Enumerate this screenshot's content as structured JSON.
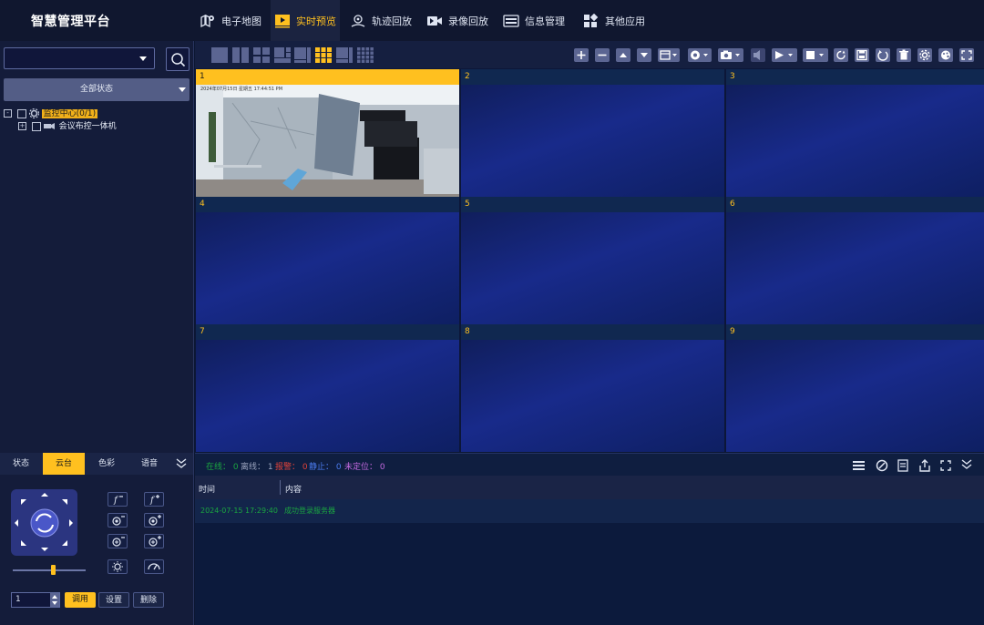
{
  "app": {
    "title": "智慧管理平台"
  },
  "nav": [
    {
      "label": "电子地图",
      "icon": "map-pin-icon",
      "active": false
    },
    {
      "label": "实时预览",
      "icon": "play-icon",
      "active": true
    },
    {
      "label": "轨迹回放",
      "icon": "location-icon",
      "active": false
    },
    {
      "label": "录像回放",
      "icon": "video-camera-icon",
      "active": false
    },
    {
      "label": "信息管理",
      "icon": "database-icon",
      "active": false
    },
    {
      "label": "其他应用",
      "icon": "apps-icon",
      "active": false
    }
  ],
  "left": {
    "device_select": {
      "value": ""
    },
    "status_select": {
      "value": "全部状态"
    },
    "tree": {
      "root": {
        "label": "监控中心(0/1)"
      },
      "child": {
        "label": "会议布控一体机"
      }
    }
  },
  "grid": {
    "cells": [
      "1",
      "2",
      "3",
      "4",
      "5",
      "6",
      "7",
      "8",
      "9"
    ],
    "selected": "1",
    "cam1_overlay": "2024年07月15日 星期五 17:44:51 PM"
  },
  "status": {
    "online_label": "在线：",
    "online": "0",
    "offline_label": "离线：",
    "offline": "1",
    "alarm_label": "报警：",
    "alarm": "0",
    "static_label": "静止：",
    "static": "0",
    "unlocated_label": "未定位：",
    "unlocated": "0",
    "colors": {
      "online": "#1aa541",
      "offline": "#9aa3bd",
      "alarm": "#e0433a",
      "static": "#4b7cf0",
      "unlocated": "#c46ae0"
    }
  },
  "log": {
    "col_time": "时间",
    "col_content": "内容",
    "rows": [
      {
        "time": "2024-07-15 17:29:40",
        "content": "成功登录服务器"
      }
    ]
  },
  "ptz": {
    "tabs": [
      "状态",
      "云台",
      "色彩",
      "语音"
    ],
    "active_tab": "云台",
    "speed": 0.55,
    "preset": "1",
    "call_label": "调用",
    "set_label": "设置",
    "delete_label": "删除"
  },
  "colors": {
    "accent": "#ffc01f",
    "bg": "#0b1632"
  }
}
